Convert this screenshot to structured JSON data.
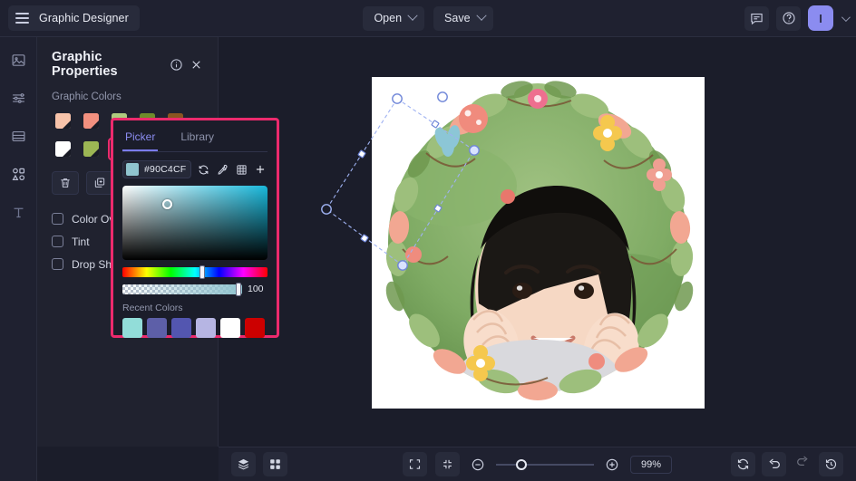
{
  "app": {
    "title": "Graphic Designer",
    "menu_icon": "hamburger-icon"
  },
  "topbar": {
    "open_label": "Open",
    "save_label": "Save",
    "comment_icon": "comment-icon",
    "help_icon": "help-circle-icon",
    "avatar_initial": "I",
    "avatar_color": "#8b8cf0"
  },
  "rail": {
    "items": [
      {
        "name": "image-icon",
        "label": "Image"
      },
      {
        "name": "adjustments-icon",
        "label": "Adjustments"
      },
      {
        "name": "layout-icon",
        "label": "Layout"
      },
      {
        "name": "shapes-icon",
        "label": "Shapes"
      },
      {
        "name": "text-icon",
        "label": "Text"
      }
    ]
  },
  "panel": {
    "title": "Graphic Properties",
    "info_icon": "info-circle-icon",
    "close_icon": "close-icon",
    "section_label": "Graphic Colors",
    "swatches": [
      {
        "color": "#f7c3aa",
        "selected": false
      },
      {
        "color": "#f2907f",
        "selected": false
      },
      {
        "color": "#aecb7e",
        "selected": false
      },
      {
        "color": "#6f8c2a",
        "selected": false
      },
      {
        "color": "#8a5520",
        "selected": false
      },
      {
        "color": "#ffffff",
        "selected": false
      },
      {
        "color": "#9cb654",
        "selected": false
      },
      {
        "color": "#90c4cf",
        "selected": true
      }
    ],
    "tools": [
      {
        "name": "delete-icon",
        "label": "Delete"
      },
      {
        "name": "duplicate-icon",
        "label": "Duplicate"
      }
    ],
    "effects": [
      {
        "label": "Color Overlay",
        "checked": false
      },
      {
        "label": "Tint",
        "checked": false
      },
      {
        "label": "Drop Shadow",
        "checked": false
      }
    ]
  },
  "picker": {
    "tabs": [
      {
        "label": "Picker",
        "active": true
      },
      {
        "label": "Library",
        "active": false
      }
    ],
    "hex": "#90C4CF",
    "swatch_color": "#90c4cf",
    "actions": [
      {
        "name": "refresh-icon",
        "label": "Reset"
      },
      {
        "name": "eyedropper-icon",
        "label": "Pick color"
      },
      {
        "name": "grid-icon",
        "label": "Palette grid"
      },
      {
        "name": "plus-icon",
        "label": "Add color"
      }
    ],
    "alpha_value": "100",
    "recent_label": "Recent Colors",
    "recent_colors": [
      "#92ddd9",
      "#5d5fa8",
      "#5356b0",
      "#b6b5e3",
      "#ffffff",
      "#cc0000"
    ],
    "border_color": "#ec2a6d"
  },
  "bottombar": {
    "left_tools": [
      {
        "name": "layers-icon",
        "label": "Layers"
      },
      {
        "name": "grid-view-icon",
        "label": "Grid view"
      }
    ],
    "center_tools": [
      {
        "name": "fit-screen-icon",
        "label": "Fit to screen"
      },
      {
        "name": "collapse-icon",
        "label": "Actual size"
      }
    ],
    "zoom_out_icon": "zoom-out-icon",
    "zoom_in_icon": "zoom-in-icon",
    "zoom_level": "99%",
    "right_tools": [
      {
        "name": "refresh-icon",
        "label": "Refresh",
        "dim": false
      },
      {
        "name": "undo-icon",
        "label": "Undo",
        "dim": false
      },
      {
        "name": "redo-icon",
        "label": "Redo",
        "dim": true
      },
      {
        "name": "history-icon",
        "label": "History",
        "dim": false
      }
    ]
  },
  "canvas": {
    "artboard_background": "#ffffff",
    "selection": {
      "rotated": true,
      "handle_color": "#ffffff",
      "outline_color": "#8ea4ef"
    }
  }
}
